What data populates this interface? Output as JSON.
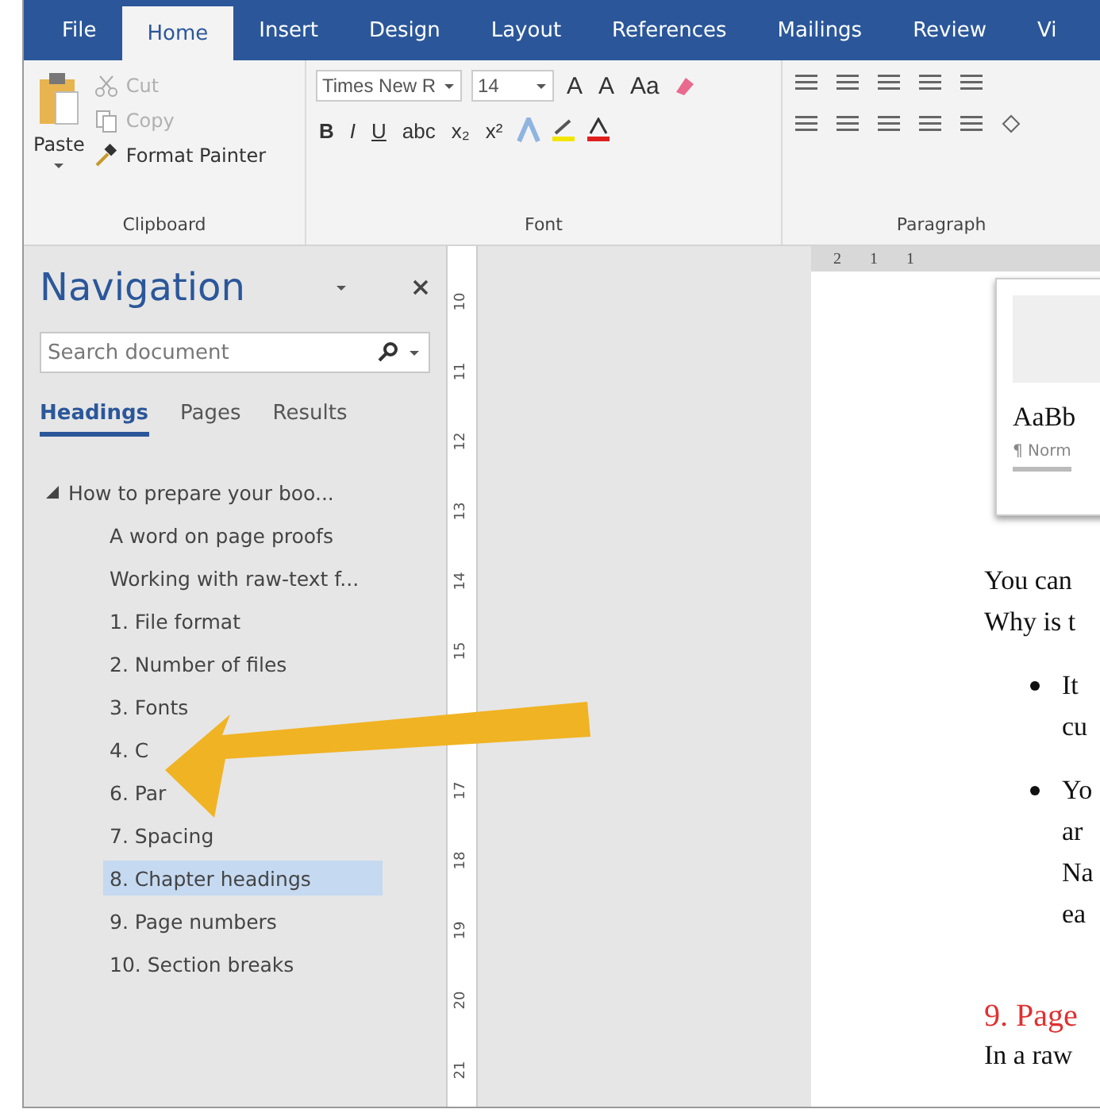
{
  "ribbon_tabs": [
    {
      "label": "File",
      "selected": false
    },
    {
      "label": "Home",
      "selected": true
    },
    {
      "label": "Insert",
      "selected": false
    },
    {
      "label": "Design",
      "selected": false
    },
    {
      "label": "Layout",
      "selected": false
    },
    {
      "label": "References",
      "selected": false
    },
    {
      "label": "Mailings",
      "selected": false
    },
    {
      "label": "Review",
      "selected": false
    },
    {
      "label": "Vi",
      "selected": false
    }
  ],
  "clipboard": {
    "paste": "Paste",
    "commands": [
      {
        "kind": "cut",
        "label": "Cut",
        "disabled": true
      },
      {
        "kind": "copy",
        "label": "Copy",
        "disabled": true
      },
      {
        "kind": "painter",
        "label": "Format Painter",
        "disabled": false
      }
    ],
    "group_label": "Clipboard"
  },
  "font": {
    "font_name": "Times New R",
    "font_size": "14",
    "row_1": [
      "A",
      "A",
      "Aa"
    ],
    "row_2": [
      "B",
      "I",
      "U",
      "abc",
      "x₂",
      "x²"
    ],
    "group_label": "Font"
  },
  "paragraph": {
    "group_label": "Paragraph"
  },
  "navigation": {
    "title": "Navigation",
    "search": {
      "placeholder": "Search document"
    },
    "tabs": [
      {
        "label": "Headings",
        "selected": true
      },
      {
        "label": "Pages",
        "selected": false
      },
      {
        "label": "Results",
        "selected": false
      }
    ],
    "tree": [
      {
        "label": "How to prepare your boo...",
        "expanded": true,
        "selected": false,
        "children": [
          {
            "label": "A word on page proofs",
            "selected": false
          },
          {
            "label": "Working with raw-text f...",
            "selected": false
          },
          {
            "label": "1. File format",
            "selected": false
          },
          {
            "label": "2. Number of files",
            "selected": false
          },
          {
            "label": "3. Fonts",
            "selected": false
          },
          {
            "label": "4. C",
            "selected": false
          },
          {
            "label": "6. Par",
            "selected": false
          },
          {
            "label": "7. Spacing",
            "selected": false
          },
          {
            "label": "8. Chapter headings",
            "selected": true
          },
          {
            "label": "9. Page numbers",
            "selected": false
          },
          {
            "label": "10. Section breaks",
            "selected": false
          }
        ]
      }
    ]
  },
  "vertical_ruler": [
    {
      "label": "10"
    },
    {
      "label": "11"
    },
    {
      "label": "12"
    },
    {
      "label": "13"
    },
    {
      "label": "14"
    },
    {
      "label": "15"
    },
    {
      "label": "17",
      "gap_before": true
    },
    {
      "label": "18"
    },
    {
      "label": "19"
    },
    {
      "label": "20"
    },
    {
      "label": "21"
    }
  ],
  "horizontal_ruler": [
    "2",
    "1",
    "1"
  ],
  "document": {
    "style_card": {
      "sample": "AaBb",
      "name": "¶ Norm"
    },
    "paragraph": [
      "You can",
      "Why is t"
    ],
    "bullets": [
      [
        "It",
        "cu"
      ],
      [
        "Yo",
        "ar",
        "Na",
        "ea"
      ]
    ],
    "heading": "9. Page",
    "body": "In a raw"
  }
}
